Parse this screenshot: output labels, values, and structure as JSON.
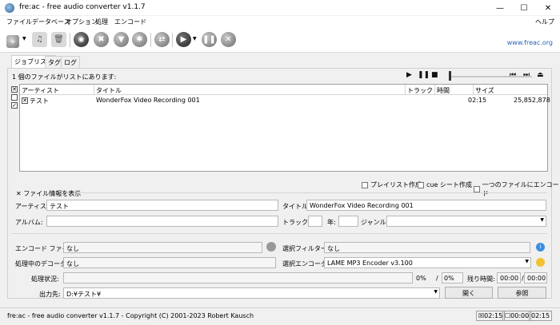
{
  "window": {
    "title": "fre:ac - free audio converter v1.1.7"
  },
  "menu": {
    "items": [
      "ファイル",
      "データベース",
      "オプション",
      "処理",
      "エンコード"
    ],
    "help": "ヘルプ"
  },
  "toolbar": {
    "link": "www.freac.org"
  },
  "tabs": [
    "ジョブリスト",
    "タグ",
    "ログ"
  ],
  "joblist": {
    "status": "1 個のファイルがリストにあります:",
    "columns": [
      "アーティスト",
      "タイトル",
      "トラック",
      "時間",
      "サイズ"
    ],
    "rows": [
      {
        "artist": "テスト",
        "title": "WonderFox Video Recording 001",
        "track": "",
        "time": "02:15",
        "size": "25,852,878"
      }
    ],
    "options": [
      "プレイリスト作成",
      "cue シート作成",
      "一つのファイルにエンコード"
    ]
  },
  "fileinfo": {
    "toggle": "ファイル情報を表示",
    "artist_label": "アーティスト:",
    "artist_value": "テスト",
    "title_label": "タイトル:",
    "title_value": "WonderFox Video Recording 001",
    "album_label": "アルバム:",
    "album_value": "",
    "track_label": "トラック:",
    "year_label": "年:",
    "genre_label": "ジャンル:"
  },
  "encode": {
    "file_label": "エンコード ファイル:",
    "file_value": "なし",
    "filter_label": "選択フィルター:",
    "filter_value": "なし",
    "decoder_label": "処理中のデコーダ:",
    "decoder_value": "なし",
    "encoder_label": "選択エンコーダ:",
    "encoder_value": "LAME MP3 Encoder v3.100",
    "progress_label": "処理状況:",
    "percent1": "0%",
    "slash": "/",
    "percent2": "0%",
    "remaining_label": "残り時間:",
    "time1": "00:00",
    "time2": "00:00",
    "output_label": "出力先:",
    "output_value": "D:¥テスト¥",
    "open_button": "開く",
    "browse_button": "参照"
  },
  "statusbar": {
    "text": "fre:ac - free audio converter v1.1.7 - Copyright (C) 2001-2023 Robert Kausch",
    "time_selected": "02:15",
    "time_unselected": "00:00",
    "time_total": "02:15"
  }
}
